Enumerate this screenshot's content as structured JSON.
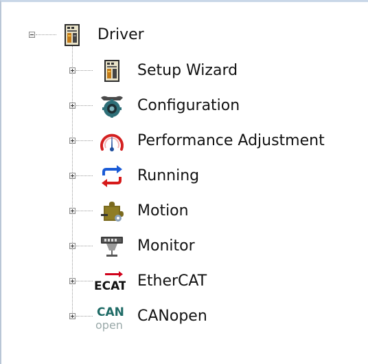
{
  "tree": {
    "root": {
      "label": "Driver",
      "icon": "driver-icon",
      "expander": "minus"
    },
    "children": [
      {
        "label": "Setup Wizard",
        "icon": "setup-wizard-icon",
        "expander": "plus"
      },
      {
        "label": "Configuration",
        "icon": "configuration-gear-icon",
        "expander": "plus"
      },
      {
        "label": "Performance Adjustment",
        "icon": "gauge-icon",
        "expander": "plus"
      },
      {
        "label": "Running",
        "icon": "running-cycle-icon",
        "expander": "plus"
      },
      {
        "label": "Motion",
        "icon": "motion-puzzle-icon",
        "expander": "plus"
      },
      {
        "label": "Monitor",
        "icon": "monitor-icon",
        "expander": "plus"
      },
      {
        "label": "EtherCAT",
        "icon": "ethercat-icon",
        "expander": "plus"
      },
      {
        "label": "CANopen",
        "icon": "canopen-icon",
        "expander": "plus"
      }
    ]
  },
  "icon_text": {
    "ethercat": "ECAT",
    "can": "CAN",
    "open": "open"
  },
  "colors": {
    "panel_border": "#b9c6d6",
    "text": "#111111",
    "ethercat_red": "#d0021b",
    "canopen_teal": "#1f6b66",
    "gauge_red": "#d42020",
    "running_blue": "#1a5bd6",
    "running_red": "#d61a1a"
  }
}
